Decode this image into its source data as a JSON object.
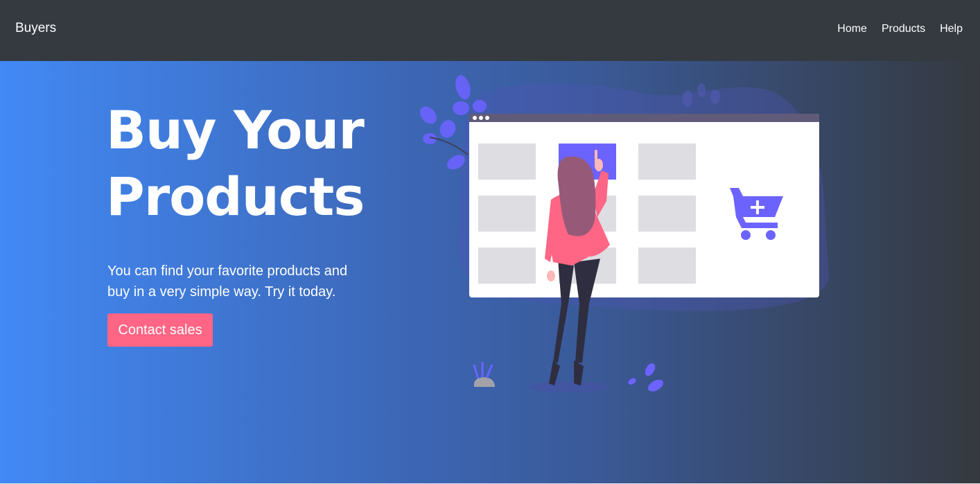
{
  "navbar": {
    "brand": "Buyers",
    "links": [
      "Home",
      "Products",
      "Help"
    ]
  },
  "hero": {
    "title_line1": "Buy Your",
    "title_line2": "Products",
    "lead": "You can find your favorite products and buy in a very simple way. Try it today.",
    "cta_label": "Contact sales"
  },
  "colors": {
    "navbar_bg": "#343a40",
    "gradient_start": "#4289f5",
    "gradient_end": "#35393f",
    "cta": "#ff6584",
    "accent": "#6c63ff"
  },
  "icons": [
    "shopping-cart-add-icon",
    "browser-window-icon"
  ]
}
